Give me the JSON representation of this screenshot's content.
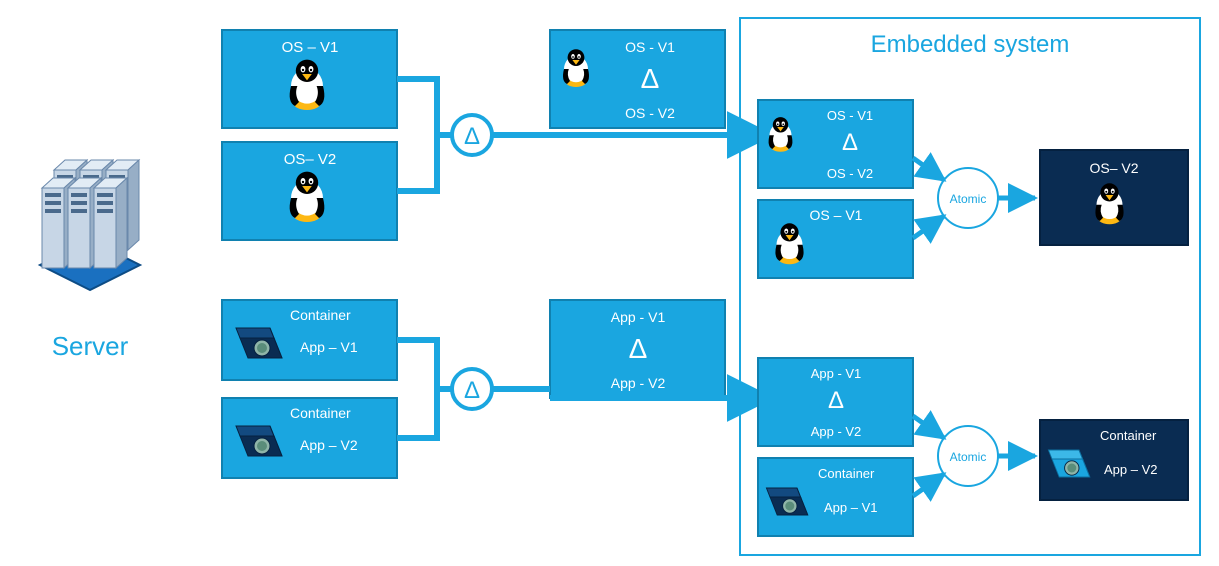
{
  "server": {
    "label": "Server"
  },
  "embedded": {
    "label": "Embedded system"
  },
  "atomic": {
    "label": "Atomic"
  },
  "os": {
    "v1": "OS – V1",
    "v2": "OS– V2",
    "d_v1": "OS - V1",
    "d_v2": "OS - V2",
    "final": "OS– V2"
  },
  "container": {
    "label": "Container",
    "app_v1": "App – V1",
    "app_v2": "App – V2",
    "d_v1": "App - V1",
    "d_v2": "App - V2",
    "final_title": "Container",
    "final_sub": "App – V2"
  },
  "delta": "Δ",
  "colors": {
    "bg": "#ffffff",
    "blue": "#1aa6e0",
    "blue_border": "#1081b0",
    "dark": "#0a2c52",
    "text_white": "#ffffff",
    "server_text": "#1aa6e0"
  }
}
